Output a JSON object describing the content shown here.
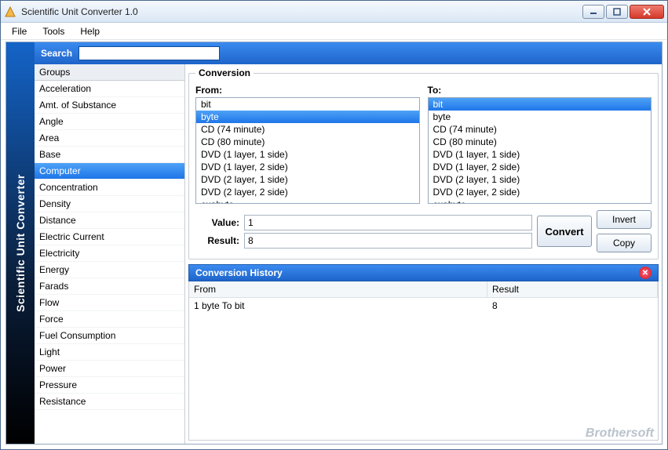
{
  "window": {
    "title": "Scientific Unit Converter 1.0"
  },
  "menu": {
    "file": "File",
    "tools": "Tools",
    "help": "Help"
  },
  "sidebar": {
    "title": "Scientific Unit Converter",
    "search_label": "Search",
    "search_value": ""
  },
  "groups": {
    "header": "Groups",
    "items": [
      "Acceleration",
      "Amt. of Substance",
      "Angle",
      "Area",
      "Base",
      "Computer",
      "Concentration",
      "Density",
      "Distance",
      "Electric Current",
      "Electricity",
      "Energy",
      "Farads",
      "Flow",
      "Force",
      "Fuel Consumption",
      "Light",
      "Power",
      "Pressure",
      "Resistance"
    ],
    "selected_index": 5
  },
  "conversion": {
    "legend": "Conversion",
    "from_label": "From:",
    "to_label": "To:",
    "units": [
      "bit",
      "byte",
      "CD (74 minute)",
      "CD (80 minute)",
      "DVD (1 layer, 1 side)",
      "DVD (1 layer, 2 side)",
      "DVD (2 layer, 1 side)",
      "DVD (2 layer, 2 side)",
      "exabyte"
    ],
    "from_selected_index": 1,
    "to_selected_index": 0,
    "value_label": "Value:",
    "result_label": "Result:",
    "value": "1",
    "result": "8",
    "convert_btn": "Convert",
    "invert_btn": "Invert",
    "copy_btn": "Copy"
  },
  "history": {
    "title": "Conversion History",
    "col_from": "From",
    "col_result": "Result",
    "rows": [
      {
        "from": "1 byte To bit",
        "result": "8"
      }
    ]
  },
  "watermark": "Brothersoft"
}
